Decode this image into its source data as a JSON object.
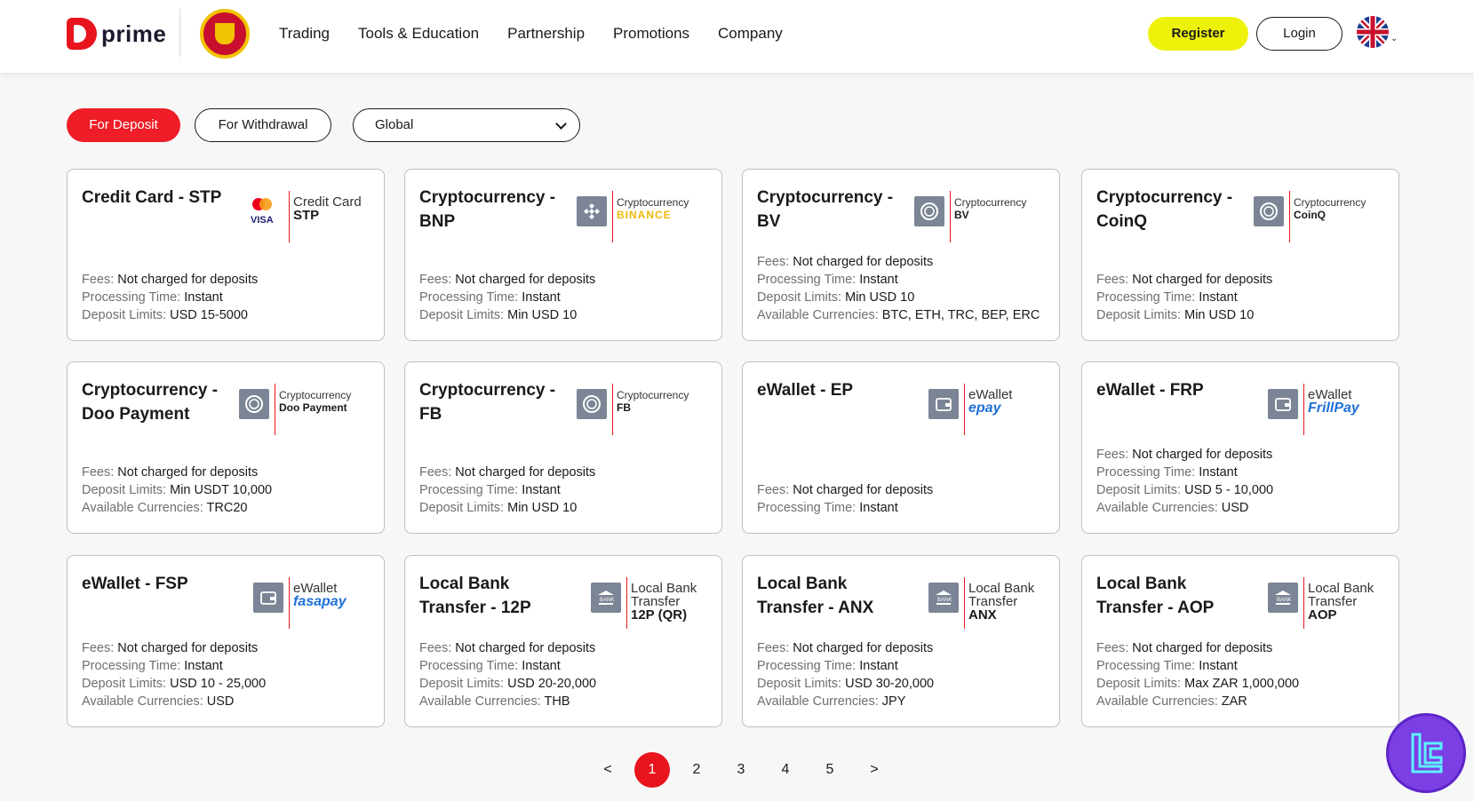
{
  "header": {
    "brand": "prime",
    "nav": [
      "Trading",
      "Tools & Education",
      "Partnership",
      "Promotions",
      "Company"
    ],
    "register_label": "Register",
    "login_label": "Login"
  },
  "filters": {
    "deposit_label": "For Deposit",
    "withdraw_label": "For Withdrawal",
    "region_value": "Global"
  },
  "cards": [
    {
      "title": "Credit Card - STP",
      "logo_caption": "Credit Card",
      "logo_sub": "STP",
      "logo_icon": "credit-card-brands-icon",
      "rows": [
        {
          "k": "Fees:",
          "v": "Not charged for deposits"
        },
        {
          "k": "Processing Time:",
          "v": "Instant"
        },
        {
          "k": "Deposit Limits:",
          "v": "USD 15-5000"
        }
      ]
    },
    {
      "title": "Cryptocurrency - BNP",
      "logo_caption": "Cryptocurrency",
      "logo_sub": "BINANCE",
      "logo_icon": "binance-icon",
      "rows": [
        {
          "k": "Fees:",
          "v": "Not charged for deposits"
        },
        {
          "k": "Processing Time:",
          "v": "Instant"
        },
        {
          "k": "Deposit Limits:",
          "v": "Min USD 10"
        }
      ]
    },
    {
      "title": "Cryptocurrency - BV",
      "logo_caption": "Cryptocurrency",
      "logo_sub": "BV",
      "logo_icon": "crypto-coin-icon",
      "rows": [
        {
          "k": "Fees:",
          "v": "Not charged for deposits"
        },
        {
          "k": "Processing Time:",
          "v": "Instant"
        },
        {
          "k": "Deposit Limits:",
          "v": "Min USD 10"
        },
        {
          "k": "Available Currencies:",
          "v": "BTC, ETH, TRC, BEP, ERC"
        }
      ]
    },
    {
      "title": "Cryptocurrency - CoinQ",
      "logo_caption": "Cryptocurrency",
      "logo_sub": "CoinQ",
      "logo_icon": "crypto-coin-icon",
      "rows": [
        {
          "k": "Fees:",
          "v": "Not charged for deposits"
        },
        {
          "k": "Processing Time:",
          "v": "Instant"
        },
        {
          "k": "Deposit Limits:",
          "v": "Min USD 10"
        }
      ]
    },
    {
      "title": "Cryptocurrency - Doo Payment",
      "logo_caption": "Cryptocurrency",
      "logo_sub": "Doo Payment",
      "logo_icon": "crypto-coin-icon",
      "rows": [
        {
          "k": "Fees:",
          "v": "Not charged for deposits"
        },
        {
          "k": "Deposit Limits:",
          "v": "Min USDT 10,000"
        },
        {
          "k": "Available Currencies:",
          "v": "TRC20"
        }
      ]
    },
    {
      "title": "Cryptocurrency - FB",
      "logo_caption": "Cryptocurrency",
      "logo_sub": "FB",
      "logo_icon": "crypto-coin-icon",
      "rows": [
        {
          "k": "Fees:",
          "v": "Not charged for deposits"
        },
        {
          "k": "Processing Time:",
          "v": "Instant"
        },
        {
          "k": "Deposit Limits:",
          "v": "Min USD 10"
        }
      ]
    },
    {
      "title": "eWallet - EP",
      "logo_caption": "eWallet",
      "logo_sub": "epay",
      "logo_icon": "wallet-icon",
      "rows": [
        {
          "k": "Fees:",
          "v": "Not charged for deposits"
        },
        {
          "k": "Processing Time:",
          "v": "Instant"
        }
      ]
    },
    {
      "title": "eWallet - FRP",
      "logo_caption": "eWallet",
      "logo_sub": "FrillPay",
      "logo_icon": "wallet-icon",
      "rows": [
        {
          "k": "Fees:",
          "v": "Not charged for deposits"
        },
        {
          "k": "Processing Time:",
          "v": "Instant"
        },
        {
          "k": "Deposit Limits:",
          "v": "USD 5 - 10,000"
        },
        {
          "k": "Available Currencies:",
          "v": "USD"
        }
      ]
    },
    {
      "title": "eWallet - FSP",
      "logo_caption": "eWallet",
      "logo_sub": "fasapay",
      "logo_icon": "wallet-icon",
      "rows": [
        {
          "k": "Fees:",
          "v": "Not charged for deposits"
        },
        {
          "k": "Processing Time:",
          "v": "Instant"
        },
        {
          "k": "Deposit Limits:",
          "v": "USD 10 - 25,000"
        },
        {
          "k": "Available Currencies:",
          "v": "USD"
        }
      ]
    },
    {
      "title": "Local Bank Transfer - 12P",
      "logo_caption": "Local Bank Transfer",
      "logo_sub": "12P (QR)",
      "logo_icon": "bank-icon",
      "rows": [
        {
          "k": "Fees:",
          "v": "Not charged for deposits"
        },
        {
          "k": "Processing Time:",
          "v": "Instant"
        },
        {
          "k": "Deposit Limits:",
          "v": "USD 20-20,000"
        },
        {
          "k": "Available Currencies:",
          "v": "THB"
        }
      ]
    },
    {
      "title": "Local Bank Transfer - ANX",
      "logo_caption": "Local Bank Transfer",
      "logo_sub": "ANX",
      "logo_icon": "bank-icon",
      "rows": [
        {
          "k": "Fees:",
          "v": "Not charged for deposits"
        },
        {
          "k": "Processing Time:",
          "v": "Instant"
        },
        {
          "k": "Deposit Limits:",
          "v": "USD 30-20,000"
        },
        {
          "k": "Available Currencies:",
          "v": "JPY"
        }
      ]
    },
    {
      "title": "Local Bank Transfer - AOP",
      "logo_caption": "Local Bank Transfer",
      "logo_sub": "AOP",
      "logo_icon": "bank-icon",
      "rows": [
        {
          "k": "Fees:",
          "v": "Not charged for deposits"
        },
        {
          "k": "Processing Time:",
          "v": "Instant"
        },
        {
          "k": "Deposit Limits:",
          "v": "Max ZAR 1,000,000"
        },
        {
          "k": "Available Currencies:",
          "v": "ZAR"
        }
      ]
    }
  ],
  "pagination": {
    "prev": "<",
    "pages": [
      "1",
      "2",
      "3",
      "4",
      "5"
    ],
    "next": ">",
    "current": "1"
  }
}
